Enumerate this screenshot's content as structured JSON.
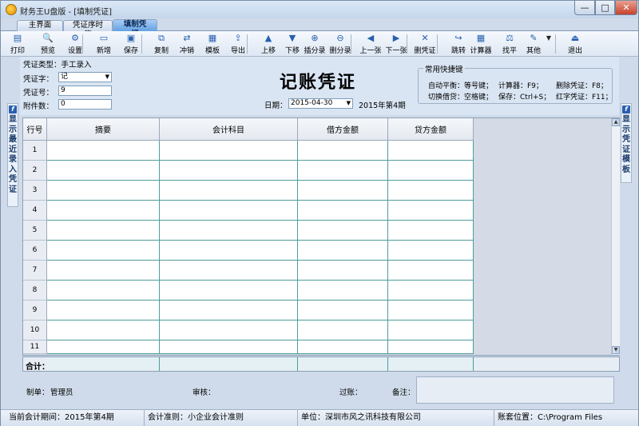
{
  "window": {
    "title": "财务王U盘版 - [填制凭证]",
    "minimize": "—",
    "maximize": "□",
    "close": "✕"
  },
  "tabs": [
    {
      "label": "主界面"
    },
    {
      "label": "凭证序时簿"
    },
    {
      "label": "填制凭证"
    }
  ],
  "toolbar": [
    {
      "label": "打印",
      "icon": "printer-icon",
      "glyph": "▤"
    },
    {
      "label": "预览",
      "icon": "preview-icon",
      "glyph": "🔍"
    },
    {
      "label": "设置",
      "icon": "settings-icon",
      "glyph": "⚙"
    },
    {
      "label": "新增",
      "icon": "new-icon",
      "glyph": "▭"
    },
    {
      "label": "保存",
      "icon": "save-icon",
      "glyph": "▣"
    },
    {
      "label": "复制",
      "icon": "copy-icon",
      "glyph": "⧉"
    },
    {
      "label": "冲销",
      "icon": "reverse-icon",
      "glyph": "⇄"
    },
    {
      "label": "模板",
      "icon": "template-icon",
      "glyph": "▦"
    },
    {
      "label": "导出",
      "icon": "export-icon",
      "glyph": "⇪"
    },
    {
      "label": "上移",
      "icon": "move-up-icon",
      "glyph": "▲"
    },
    {
      "label": "下移",
      "icon": "move-down-icon",
      "glyph": "▼"
    },
    {
      "label": "插分录",
      "icon": "insert-entry-icon",
      "glyph": "⊕"
    },
    {
      "label": "删分录",
      "icon": "delete-entry-icon",
      "glyph": "⊖"
    },
    {
      "label": "上一张",
      "icon": "prev-icon",
      "glyph": "◀"
    },
    {
      "label": "下一张",
      "icon": "next-icon",
      "glyph": "▶"
    },
    {
      "label": "删凭证",
      "icon": "delete-voucher-icon",
      "glyph": "✕"
    },
    {
      "label": "跳转",
      "icon": "jump-icon",
      "glyph": "↪"
    },
    {
      "label": "计算器",
      "icon": "calculator-icon",
      "glyph": "▦"
    },
    {
      "label": "找平",
      "icon": "balance-icon",
      "glyph": "⚖"
    },
    {
      "label": "其他",
      "icon": "other-icon",
      "glyph": "✎"
    },
    {
      "label": "退出",
      "icon": "exit-icon",
      "glyph": "⏏"
    }
  ],
  "toolbar_more": "▼",
  "form": {
    "type_label": "凭证类型：手工录入",
    "word_label": "凭证字：",
    "word_value": "记",
    "number_label": "凭证号：",
    "number_value": "9",
    "attach_label": "附件数：",
    "attach_value": "0",
    "title": "记账凭证",
    "date_label": "日期：",
    "date_value": "2015-04-30",
    "period_text": "2015年第4期"
  },
  "shortcuts": {
    "title": "常用快捷键",
    "items": [
      "自动平衡：等号键；",
      "计算器：F9；",
      "删除凭证：F8；",
      "切换借贷：空格键；",
      "保存：Ctrl+S；",
      "红字凭证：F11；"
    ]
  },
  "side_left": {
    "badge": "f",
    "text": "显示最近录入凭证"
  },
  "side_right": {
    "badge": "f",
    "text": "显示凭证模板"
  },
  "grid": {
    "headers": [
      "行号",
      "摘要",
      "会计科目",
      "借方金额",
      "贷方金额"
    ],
    "rows": [
      "1",
      "2",
      "3",
      "4",
      "5",
      "6",
      "7",
      "8",
      "9",
      "10",
      "11"
    ],
    "sum_label": "合计：",
    "scroll_up": "▲",
    "scroll_down": "▼"
  },
  "footer": {
    "maker_label": "制单：",
    "maker_value": "管理员",
    "audit_label": "审核：",
    "post_label": "过账：",
    "note_label": "备注："
  },
  "status": [
    "当前会计期间：2015年第4期",
    "会计准则：小企业会计准则",
    "单位：深圳市风之讯科技有限公司",
    "账套位置：C:\\Program Files"
  ]
}
